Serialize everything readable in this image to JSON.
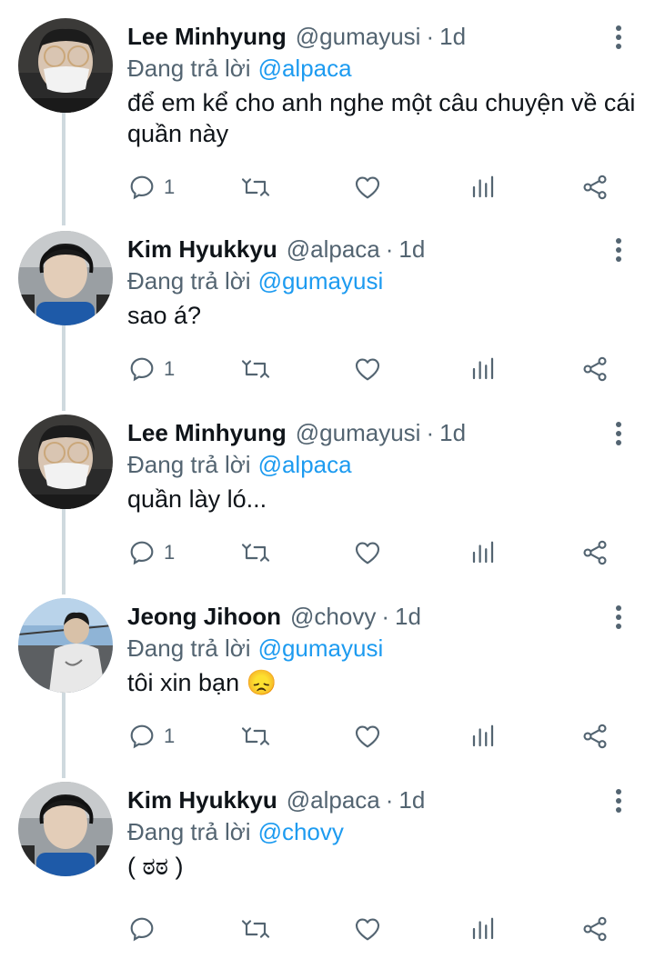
{
  "tweets": [
    {
      "name": "Lee Minhyung",
      "handle": "@gumayusi",
      "time": "1d",
      "reply_prefix": "Đang trả lời",
      "reply_to": "@alpaca",
      "text": "để em kể cho anh nghe một câu chuyện về cái quần này",
      "reply_count": "1",
      "avatar": "person-mask-avatar"
    },
    {
      "name": "Kim Hyukkyu",
      "handle": "@alpaca",
      "time": "1d",
      "reply_prefix": "Đang trả lời",
      "reply_to": "@gumayusi",
      "text": "sao á?",
      "reply_count": "1",
      "avatar": "person-headset-avatar"
    },
    {
      "name": "Lee Minhyung",
      "handle": "@gumayusi",
      "time": "1d",
      "reply_prefix": "Đang trả lời",
      "reply_to": "@alpaca",
      "text": "quần lày ló...",
      "reply_count": "1",
      "avatar": "person-mask-avatar"
    },
    {
      "name": "Jeong Jihoon",
      "handle": "@chovy",
      "time": "1d",
      "reply_prefix": "Đang trả lời",
      "reply_to": "@gumayusi",
      "text": "tôi xin bạn 😞",
      "reply_count": "1",
      "avatar": "person-outdoor-avatar"
    },
    {
      "name": "Kim Hyukkyu",
      "handle": "@alpaca",
      "time": "1d",
      "reply_prefix": "Đang trả lời",
      "reply_to": "@chovy",
      "text": "( ಠಠ )",
      "reply_count": "",
      "avatar": "person-headset-avatar"
    }
  ],
  "separator": "·",
  "colors": {
    "text": "#0f1419",
    "secondary": "#536471",
    "link": "#1d9bf0",
    "thread_line": "#cfd9de"
  }
}
